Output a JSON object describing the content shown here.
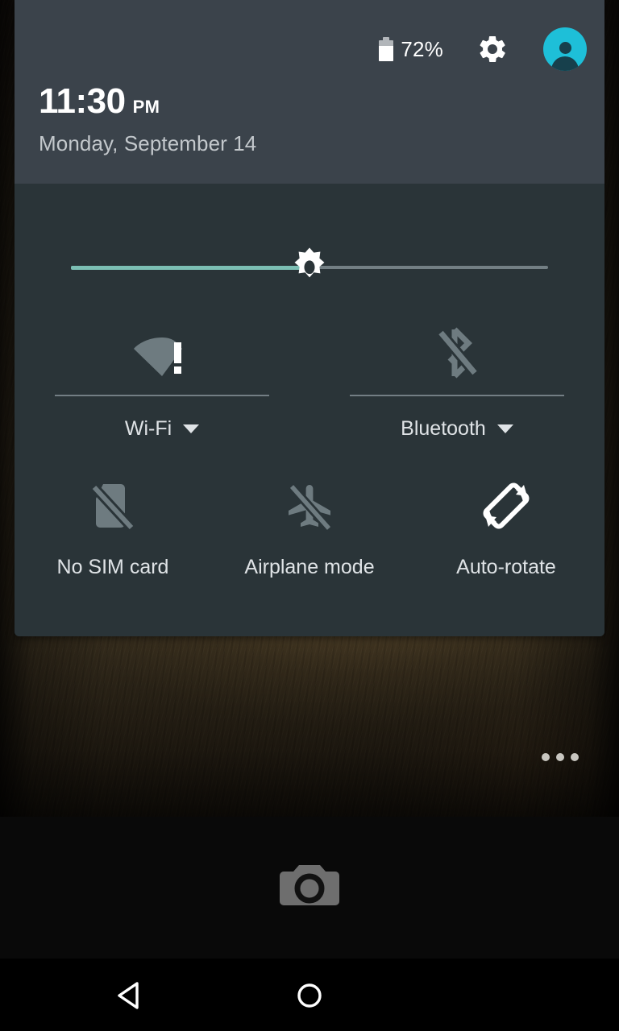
{
  "statusbar": {
    "battery_percent": "72%",
    "battery_level": 72,
    "battery_icon": "battery-icon",
    "settings_icon": "gear-icon",
    "avatar_icon": "user-avatar-icon",
    "avatar_color": "#1ebfd8"
  },
  "clock": {
    "time": "11:30",
    "ampm": "PM",
    "date": "Monday, September 14"
  },
  "brightness": {
    "name": "brightness-slider",
    "icon": "brightness-sun-icon",
    "value": 50,
    "fill_color": "#7cbfb4",
    "track_color": "#737f84"
  },
  "tiles_dual": [
    {
      "label": "Wi-Fi",
      "icon": "wifi-no-internet-icon",
      "state": "warning",
      "has_caret": true,
      "caret_icon": "chevron-down-icon"
    },
    {
      "label": "Bluetooth",
      "icon": "bluetooth-disabled-icon",
      "state": "off",
      "has_caret": true,
      "caret_icon": "chevron-down-icon"
    }
  ],
  "tiles_triple": [
    {
      "label": "No SIM card",
      "icon": "sim-card-off-icon",
      "state": "off"
    },
    {
      "label": "Airplane mode",
      "icon": "airplane-off-icon",
      "state": "off"
    },
    {
      "label": "Auto-rotate",
      "icon": "auto-rotate-icon",
      "state": "on"
    }
  ],
  "home": {
    "more_options_icon": "more-options-dots-icon",
    "camera_shortcut_icon": "camera-icon"
  },
  "navbar": {
    "back_icon": "back-triangle-icon",
    "home_icon": "home-circle-icon"
  },
  "colors": {
    "panel_header": "#3b434b",
    "panel_body": "#2a3438",
    "label_text": "#dfe3e6",
    "icon_off": "#6e7b80",
    "icon_on": "#ffffff"
  }
}
